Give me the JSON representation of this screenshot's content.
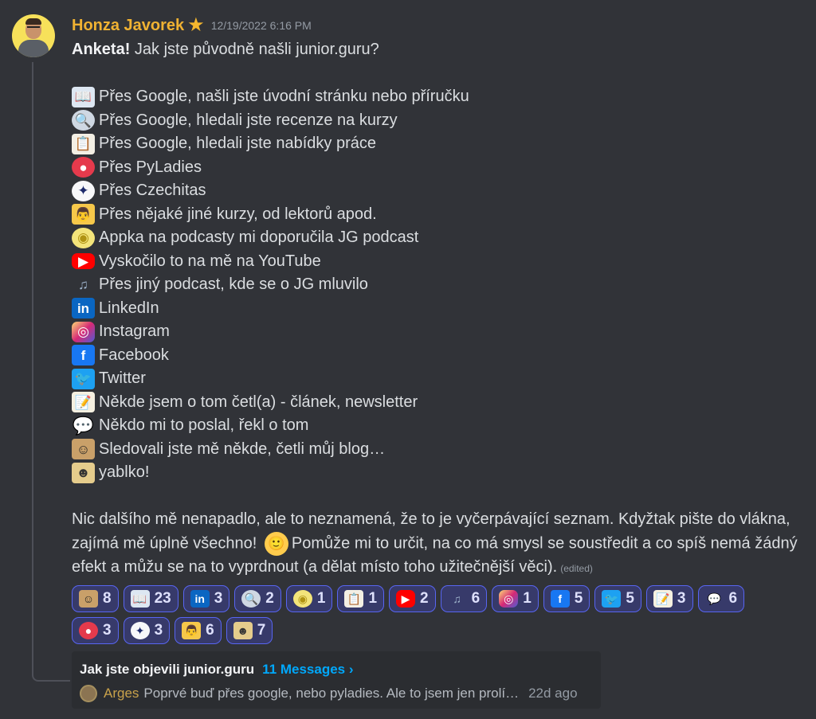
{
  "message": {
    "author": "Honza Javorek",
    "timestamp": "12/19/2022 6:16 PM",
    "intro_bold": "Anketa!",
    "intro_rest": " Jak jste původně našli junior.guru?",
    "options": [
      {
        "icon": "open-book-icon",
        "glyph": "📖",
        "cls": "e-book",
        "text": "Přes Google, našli jste úvodní stránku nebo příručku"
      },
      {
        "icon": "magnifier-icon",
        "glyph": "🔍",
        "cls": "e-search",
        "text": "Přes Google, hledali jste recenze na kurzy"
      },
      {
        "icon": "clipboard-icon",
        "glyph": "📋",
        "cls": "e-clip",
        "text": "Přes Google, hledali jste nabídky práce"
      },
      {
        "icon": "pyladies-icon",
        "glyph": "●",
        "cls": "e-pyladies",
        "text": "Přes PyLadies"
      },
      {
        "icon": "czechitas-icon",
        "glyph": "✦",
        "cls": "e-czechitas",
        "text": "Přes Czechitas"
      },
      {
        "icon": "teacher-icon",
        "glyph": "👨",
        "cls": "e-teacher",
        "text": "Přes nějaké jiné kurzy, od lektorů apod."
      },
      {
        "icon": "podcast-icon",
        "glyph": "◉",
        "cls": "e-podcast",
        "text": "Appka na podcasty mi doporučila JG podcast"
      },
      {
        "icon": "youtube-icon",
        "glyph": "▶",
        "cls": "e-youtube",
        "text": "Vyskočilo to na mě na YouTube"
      },
      {
        "icon": "headphones-music-icon",
        "glyph": "♫",
        "cls": "e-music",
        "text": "Přes jiný podcast, kde se o JG mluvilo"
      },
      {
        "icon": "linkedin-icon",
        "glyph": "in",
        "cls": "e-linkedin",
        "text": "LinkedIn"
      },
      {
        "icon": "instagram-icon",
        "glyph": "◎",
        "cls": "e-instagram",
        "text": "Instagram"
      },
      {
        "icon": "facebook-icon",
        "glyph": "f",
        "cls": "e-facebook",
        "text": "Facebook"
      },
      {
        "icon": "twitter-icon",
        "glyph": "🐦",
        "cls": "e-twitter",
        "text": "Twitter"
      },
      {
        "icon": "memo-icon",
        "glyph": "📝",
        "cls": "e-memo",
        "text": "Někde jsem o tom četl(a) - článek, newsletter"
      },
      {
        "icon": "speech-bubble-icon",
        "glyph": "💬",
        "cls": "e-speech",
        "text": "Někdo mi to poslal, řekl o tom"
      },
      {
        "icon": "honza-face-icon",
        "glyph": "☺",
        "cls": "e-face1",
        "text": "Sledovali jste mě někde, četli můj blog…"
      },
      {
        "icon": "yablko-face-icon",
        "glyph": "☻",
        "cls": "e-face2",
        "text": "yablko!"
      }
    ],
    "closing_part1": "Nic dalšího mě nenapadlo, ale to neznamená, že to je vyčerpávající seznam. Kdyžtak pište do vlákna, zajímá mě úplně všechno!",
    "closing_smiley": "🙂",
    "closing_part2": "Pomůže mi to určit, na co má smysl se soustředit a co spíš nemá žádný efekt a můžu se na to vyprdnout (a dělat místo toho užitečnější věci).",
    "edited_label": "(edited)"
  },
  "reactions": [
    {
      "icon": "honza-face-icon",
      "glyph": "☺",
      "cls": "e-face1",
      "count": "8"
    },
    {
      "icon": "open-book-icon",
      "glyph": "📖",
      "cls": "e-book",
      "count": "23"
    },
    {
      "icon": "linkedin-icon",
      "glyph": "in",
      "cls": "e-linkedin",
      "count": "3"
    },
    {
      "icon": "magnifier-icon",
      "glyph": "🔍",
      "cls": "e-search",
      "count": "2"
    },
    {
      "icon": "podcast-icon",
      "glyph": "◉",
      "cls": "e-podcast",
      "count": "1"
    },
    {
      "icon": "clipboard-icon",
      "glyph": "📋",
      "cls": "e-clip",
      "count": "1"
    },
    {
      "icon": "youtube-icon",
      "glyph": "▶",
      "cls": "e-youtube",
      "count": "2"
    },
    {
      "icon": "headphones-music-icon",
      "glyph": "♫",
      "cls": "e-music",
      "count": "6"
    },
    {
      "icon": "instagram-icon",
      "glyph": "◎",
      "cls": "e-instagram",
      "count": "1"
    },
    {
      "icon": "facebook-icon",
      "glyph": "f",
      "cls": "e-facebook",
      "count": "5"
    },
    {
      "icon": "twitter-icon",
      "glyph": "🐦",
      "cls": "e-twitter",
      "count": "5"
    },
    {
      "icon": "memo-icon",
      "glyph": "📝",
      "cls": "e-memo",
      "count": "3"
    },
    {
      "icon": "speech-bubble-icon",
      "glyph": "💬",
      "cls": "e-speech",
      "count": "6"
    },
    {
      "icon": "pyladies-icon",
      "glyph": "●",
      "cls": "e-pyladies",
      "count": "3"
    },
    {
      "icon": "czechitas-icon",
      "glyph": "✦",
      "cls": "e-czechitas",
      "count": "3"
    },
    {
      "icon": "teacher-icon",
      "glyph": "👨",
      "cls": "e-teacher",
      "count": "6"
    },
    {
      "icon": "yablko-face-icon",
      "glyph": "☻",
      "cls": "e-face2",
      "count": "7"
    }
  ],
  "thread": {
    "title": "Jak jste objevili junior.guru",
    "messages_link": "11 Messages ›",
    "preview_author": "Arges",
    "preview_text": "Poprvé buď přes google, nebo pyladies. Ale to jsem jen prolí…",
    "preview_time": "22d ago"
  },
  "colors": {
    "background": "#313338",
    "username": "#f0b232",
    "reaction_bg": "#373a6a",
    "reaction_border": "#5865f2",
    "link": "#00a8fc"
  }
}
